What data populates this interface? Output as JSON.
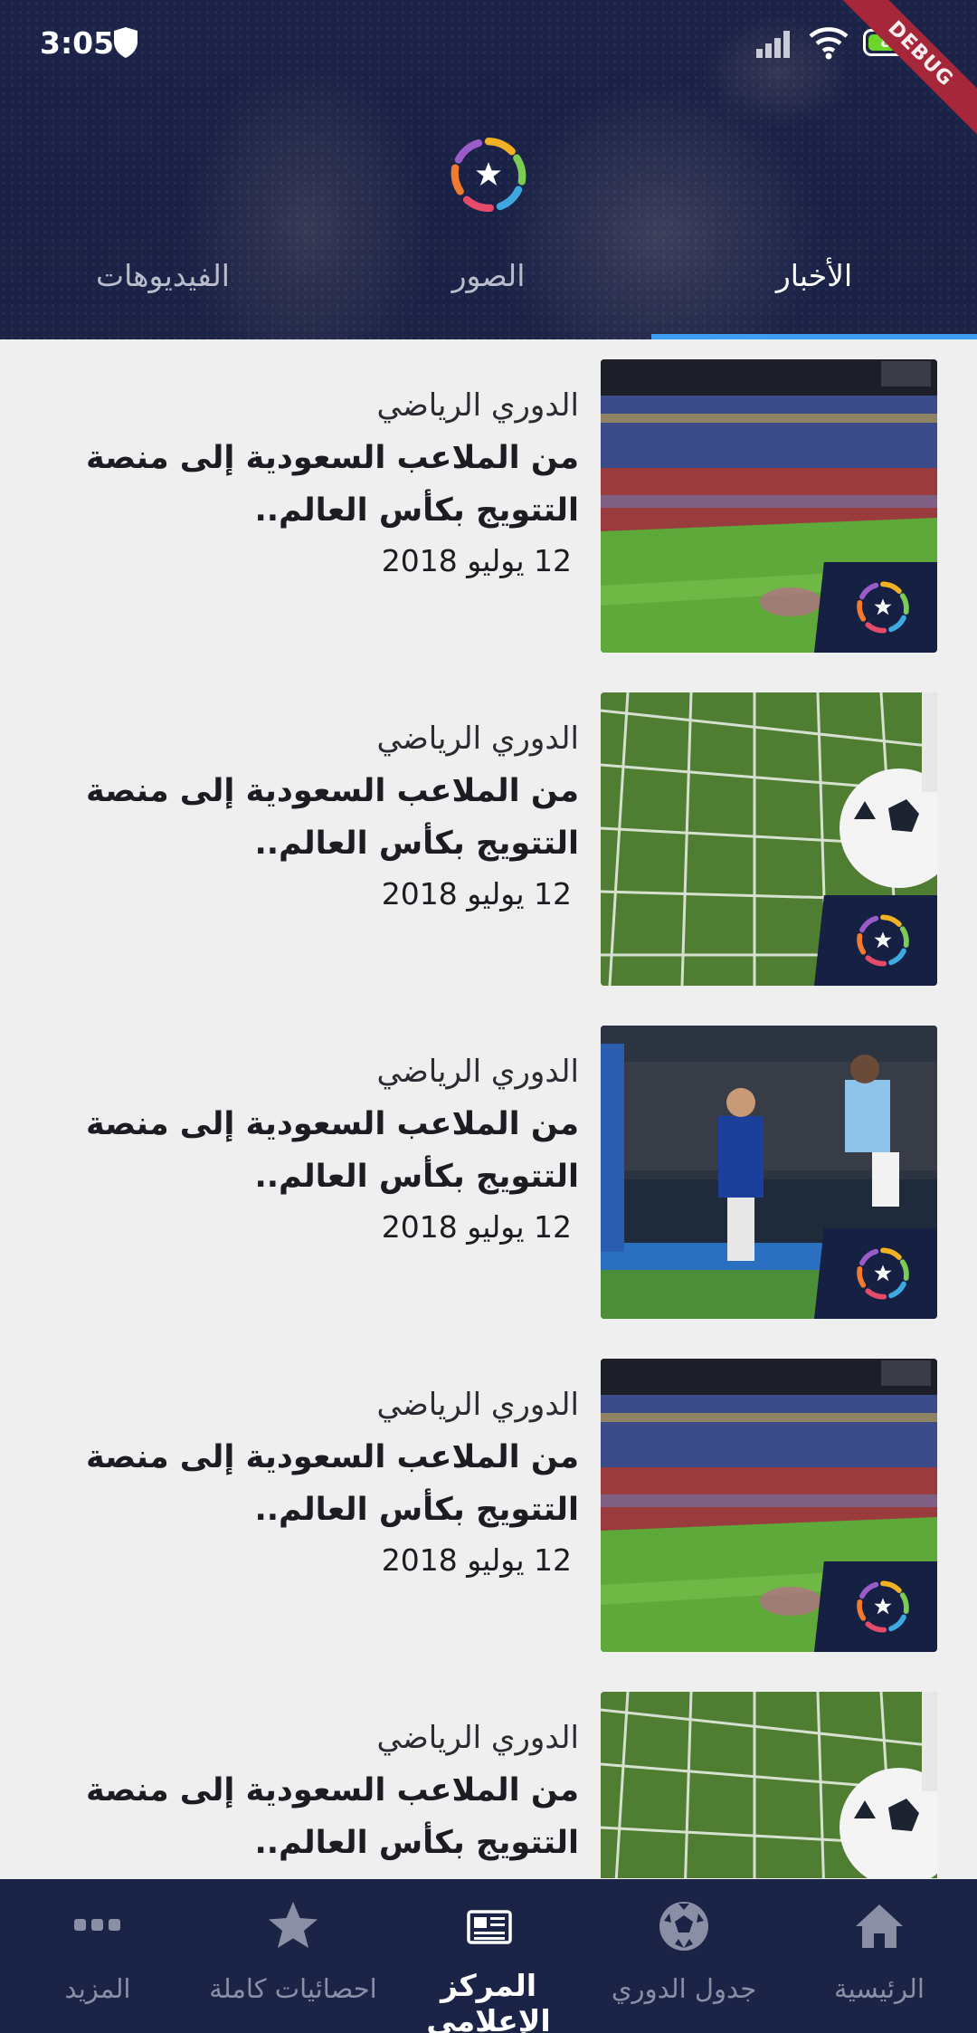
{
  "status_bar": {
    "time": "3:05",
    "battery_level": "87",
    "debug_banner": "DEBUG",
    "battery_color": "#6bd52a"
  },
  "header": {
    "logo": "league-logo",
    "tabs": [
      {
        "label": "الأخبار",
        "active": true
      },
      {
        "label": "الصور",
        "active": false
      },
      {
        "label": "الفيديوهات",
        "active": false
      }
    ],
    "background_color": "#1c2348",
    "indicator_color": "#3d9df0"
  },
  "news": [
    {
      "category": "الدوري الرياضي",
      "title": "من الملاعب السعودية إلى منصة التتويج بكأس العالم..",
      "date": "12 يوليو 2018",
      "image": "stadium-crowd"
    },
    {
      "category": "الدوري الرياضي",
      "title": "من الملاعب السعودية إلى منصة التتويج بكأس العالم..",
      "date": "12 يوليو 2018",
      "image": "ball-in-net"
    },
    {
      "category": "الدوري الرياضي",
      "title": "من الملاعب السعودية إلى منصة التتويج بكأس العالم..",
      "date": "12 يوليو 2018",
      "image": "players-match"
    },
    {
      "category": "الدوري الرياضي",
      "title": "من الملاعب السعودية إلى منصة التتويج بكأس العالم..",
      "date": "12 يوليو 2018",
      "image": "stadium-crowd"
    },
    {
      "category": "الدوري الرياضي",
      "title": "من الملاعب السعودية إلى منصة التتويج بكأس العالم..",
      "date": "",
      "image": "ball-in-net"
    }
  ],
  "bottom_nav": [
    {
      "label": "الرئيسية",
      "icon": "home-icon",
      "active": false
    },
    {
      "label": "جدول الدوري",
      "icon": "soccer-ball-icon",
      "active": false
    },
    {
      "label": "المركز الإعلامي",
      "icon": "newspaper-icon",
      "active": true
    },
    {
      "label": "احصائيات كاملة",
      "icon": "star-icon",
      "active": false
    },
    {
      "label": "المزيد",
      "icon": "more-icon",
      "active": false
    }
  ]
}
